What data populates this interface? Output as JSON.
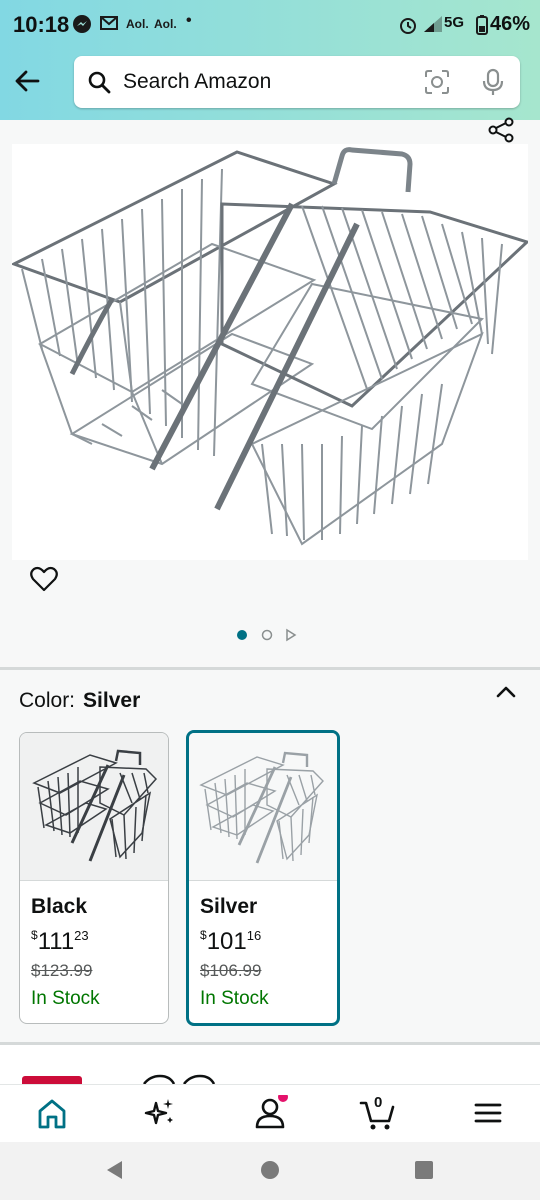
{
  "status_bar": {
    "time": "10:18",
    "notif1": "Aol.",
    "notif2": "Aol.",
    "dot": "•",
    "network": "5G",
    "battery": "46%"
  },
  "search": {
    "placeholder": "Search Amazon"
  },
  "product_gallery": {
    "image_count": 2,
    "active_index": 0
  },
  "color": {
    "label": "Color:",
    "selected": "Silver",
    "options": [
      {
        "name": "Black",
        "currency": "$",
        "whole": "111",
        "cents": "23",
        "list_price": "$123.99",
        "stock": "In Stock",
        "selected": false
      },
      {
        "name": "Silver",
        "currency": "$",
        "whole": "101",
        "cents": "16",
        "list_price": "$106.99",
        "stock": "In Stock",
        "selected": true
      }
    ]
  },
  "cart": {
    "count": "0"
  },
  "colors": {
    "accent": "#007185",
    "stock_green": "#007600",
    "deal_red": "#cc0c39",
    "header_gradient_start": "#82d8e3",
    "header_gradient_end": "#a6e6ce"
  },
  "icons": [
    "back-arrow-icon",
    "search-icon",
    "camera-lens-icon",
    "microphone-icon",
    "share-icon",
    "heart-icon",
    "chevron-up-icon",
    "home-icon",
    "sparkle-icon",
    "user-icon",
    "cart-icon",
    "menu-icon"
  ]
}
